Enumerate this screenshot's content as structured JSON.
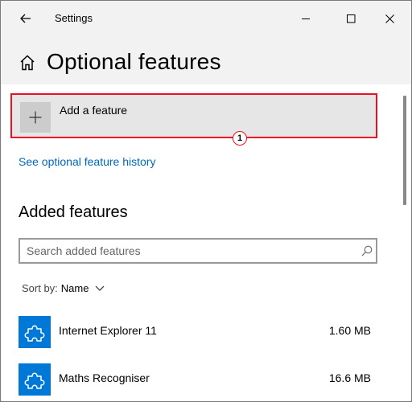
{
  "window": {
    "title": "Settings"
  },
  "page": {
    "title": "Optional features"
  },
  "add_feature": {
    "label": "Add a feature"
  },
  "annotation": {
    "step": "1"
  },
  "history_link": "See optional feature history",
  "added_features": {
    "heading": "Added features",
    "search_placeholder": "Search added features",
    "sort_label": "Sort by:",
    "sort_value": "Name",
    "items": [
      {
        "name": "Internet Explorer 11",
        "size": "1.60 MB"
      },
      {
        "name": "Maths Recogniser",
        "size": "16.6 MB"
      }
    ]
  },
  "colors": {
    "accent": "#0078d7",
    "link": "#0067c0",
    "highlight_border": "#e81123"
  },
  "icons": [
    "back-arrow-icon",
    "minimize-icon",
    "maximize-icon",
    "close-icon",
    "home-icon",
    "plus-icon",
    "search-icon",
    "chevron-down-icon",
    "puzzle-piece-icon"
  ]
}
